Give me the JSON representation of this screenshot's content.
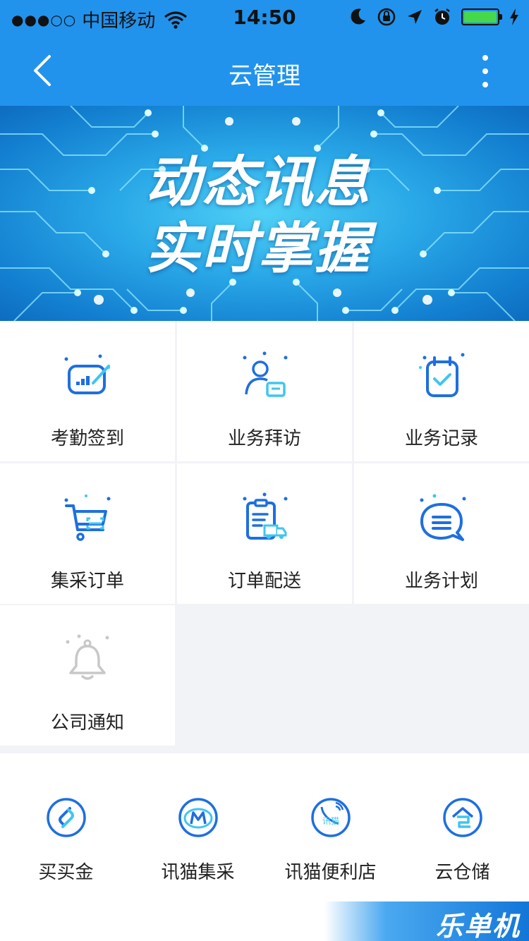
{
  "status_bar": {
    "signal": "●●●○○",
    "carrier": "中国移动",
    "time": "14:50"
  },
  "nav": {
    "title": "云管理"
  },
  "banner": {
    "line1": "动态讯息",
    "line2": "实时掌握"
  },
  "grid": {
    "items": [
      {
        "label": "考勤签到",
        "icon": "attendance-icon"
      },
      {
        "label": "业务拜访",
        "icon": "visit-icon"
      },
      {
        "label": "业务记录",
        "icon": "record-icon"
      },
      {
        "label": "集采订单",
        "icon": "cart-icon"
      },
      {
        "label": "订单配送",
        "icon": "delivery-icon"
      },
      {
        "label": "业务计划",
        "icon": "plan-icon"
      },
      {
        "label": "公司通知",
        "icon": "bell-icon"
      }
    ]
  },
  "services": [
    {
      "label": "买买金",
      "icon": "maimaijin-icon"
    },
    {
      "label": "讯猫集采",
      "icon": "xunmao-jicai-icon"
    },
    {
      "label": "讯猫便利店",
      "icon": "xunmao-store-icon",
      "icon_text": "讯猫"
    },
    {
      "label": "云仓储",
      "icon": "cloud-storage-icon"
    }
  ],
  "watermark": "乐单机",
  "colors": {
    "primary": "#2193ec",
    "icon_blue": "#1e6fe0",
    "accent_cyan": "#3ec6f0",
    "disabled": "#c8c8c8",
    "battery": "#44d84a"
  }
}
